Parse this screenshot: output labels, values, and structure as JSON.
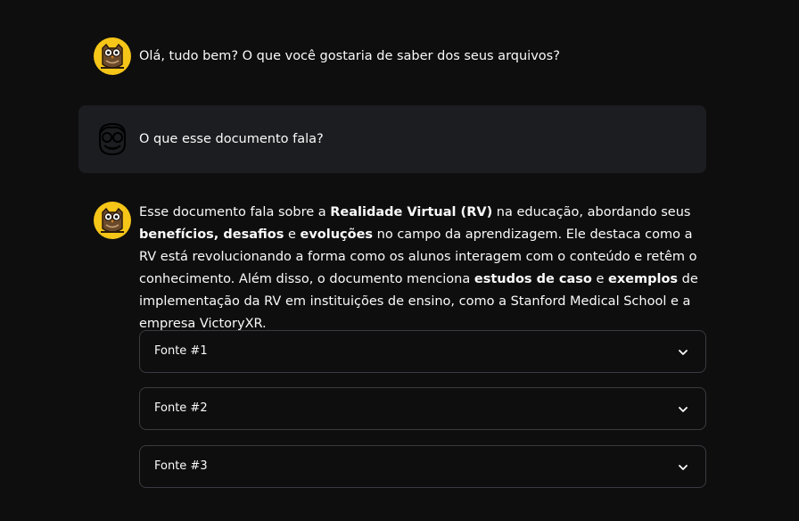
{
  "messages": [
    {
      "role": "assistant",
      "avatar_icon": "owl-icon",
      "text": "Olá, tudo bem? O que você gostaria de saber dos seus arquivos?"
    },
    {
      "role": "user",
      "avatar_icon": "user-glasses-icon",
      "text": "O que esse documento fala?"
    },
    {
      "role": "assistant",
      "avatar_icon": "owl-icon",
      "segments": [
        {
          "t": "Esse documento fala sobre a ",
          "b": false
        },
        {
          "t": "Realidade Virtual (RV)",
          "b": true
        },
        {
          "t": " na educação, abordando seus ",
          "b": false
        },
        {
          "t": "benefícios, desafios",
          "b": true
        },
        {
          "t": " e ",
          "b": false
        },
        {
          "t": "evoluções",
          "b": true
        },
        {
          "t": " no campo da aprendizagem. Ele destaca como a RV está revolucionando a forma como os alunos interagem com o conteúdo e retêm o conhecimento. Além disso, o documento menciona ",
          "b": false
        },
        {
          "t": "estudos de caso",
          "b": true
        },
        {
          "t": " e ",
          "b": false
        },
        {
          "t": "exemplos",
          "b": true
        },
        {
          "t": " de implementação da RV em instituições de ensino, como a Stanford Medical School e a empresa VictoryXR.",
          "b": false
        }
      ]
    }
  ],
  "sources": [
    {
      "label": "Fonte #1",
      "icon": "chevron-down-icon"
    },
    {
      "label": "Fonte #2",
      "icon": "chevron-down-icon"
    },
    {
      "label": "Fonte #3",
      "icon": "chevron-down-icon"
    }
  ],
  "colors": {
    "background": "#0e0e0e",
    "user_bubble": "#1c1d21",
    "owl_yellow": "#f5c518",
    "text": "#fafafa",
    "border": "#3a3b40"
  }
}
